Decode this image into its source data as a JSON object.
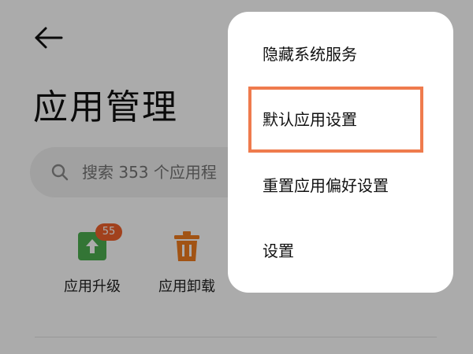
{
  "header": {
    "back_icon": "arrow-left-icon",
    "title": "应用管理"
  },
  "search": {
    "icon": "search-icon",
    "placeholder": "搜索 353 个应用程"
  },
  "tools": [
    {
      "icon": "app-upgrade-icon",
      "label": "应用升级",
      "badge": "55",
      "color": "#4caf50"
    },
    {
      "icon": "trash-icon",
      "label": "应用卸载",
      "color": "#f07c1e"
    }
  ],
  "menu": {
    "items": [
      {
        "label": "隐藏系统服务"
      },
      {
        "label": "默认应用设置",
        "highlighted": true
      },
      {
        "label": "重置应用偏好设置"
      },
      {
        "label": "设置"
      }
    ]
  },
  "colors": {
    "highlight": "#ef7b4d",
    "badge": "#f0612c"
  }
}
